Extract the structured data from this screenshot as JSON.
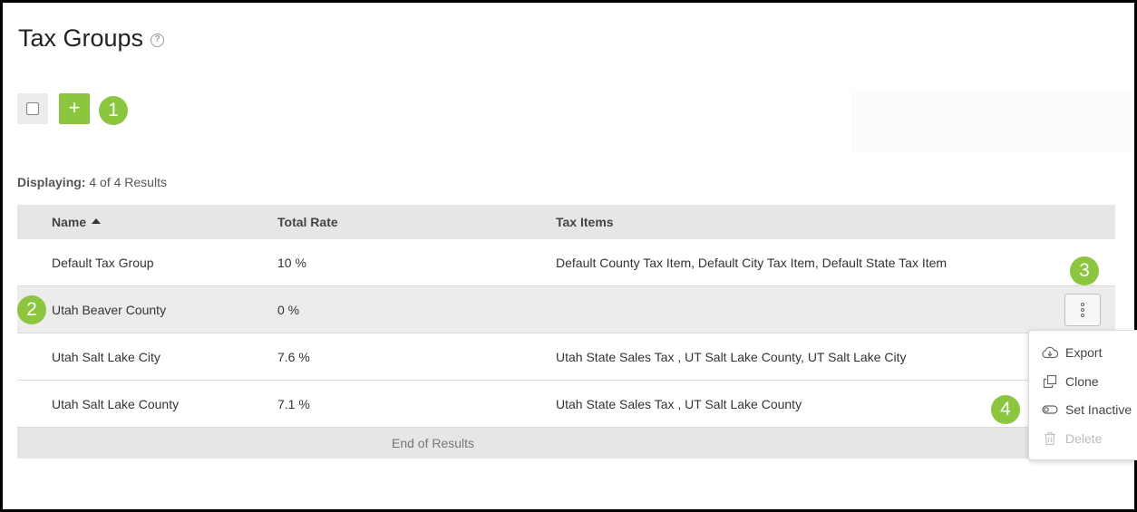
{
  "page": {
    "title": "Tax Groups"
  },
  "displaying": {
    "label": "Displaying:",
    "value": "4 of 4 Results"
  },
  "toolbar": {
    "add_label": "+"
  },
  "columns": [
    "Name",
    "Total Rate",
    "Tax Items"
  ],
  "rows": [
    {
      "name": "Default Tax Group",
      "rate": "10 %",
      "items": "Default County Tax Item, Default City Tax Item, Default State Tax Item"
    },
    {
      "name": "Utah Beaver County",
      "rate": "0 %",
      "items": ""
    },
    {
      "name": "Utah Salt Lake City",
      "rate": "7.6 %",
      "items": "Utah State Sales Tax , UT Salt Lake County, UT Salt Lake City"
    },
    {
      "name": "Utah Salt Lake County",
      "rate": "7.1 %",
      "items": "Utah State Sales Tax , UT Salt Lake County"
    }
  ],
  "end_text": "End of Results",
  "menu": {
    "export": "Export",
    "clone": "Clone",
    "set_inactive": "Set Inactive",
    "delete": "Delete"
  },
  "callouts": {
    "one": "1",
    "two": "2",
    "three": "3",
    "four": "4"
  },
  "colors": {
    "accent": "#8cc63f",
    "header_bg": "#e6e6e6",
    "row_alt": "#ececec"
  },
  "icons": {
    "help": "help-circle-icon",
    "kebab": "more-vertical-icon",
    "export": "cloud-download-icon",
    "clone": "copy-icon",
    "set_inactive": "toggle-icon",
    "delete": "trash-icon"
  }
}
